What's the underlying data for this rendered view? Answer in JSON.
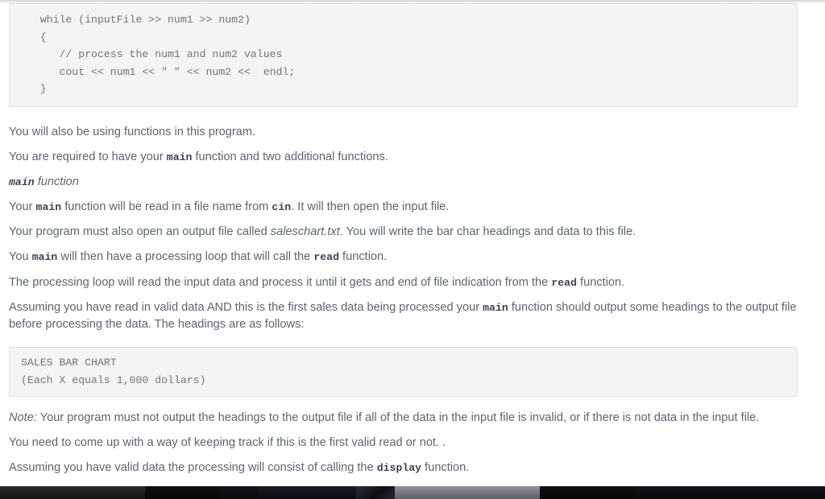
{
  "document": {
    "code_block_1": "   while (inputFile >> num1 >> num2)\n   {\n      // process the num1 and num2 values\n      cout << num1 << \" \" << num2 <<  endl;\n   }",
    "code_block_2": "SALES BAR CHART\n(Each X equals 1,000 dollars)",
    "p1": "You will also be using functions in this program.",
    "p2": {
      "a": "You are required to have your ",
      "code": "main",
      "b": " function and two additional functions."
    },
    "h1": {
      "code": "main",
      "text": " function"
    },
    "p3": {
      "a": "Your ",
      "code1": "main",
      "b": " function will be read in a file name from ",
      "code2": "cin",
      "c": ". It will then open the input file."
    },
    "p4": {
      "a": "Your program must also open an output file called ",
      "italic": "saleschart.txt",
      "b": ". You will write the bar char headings and data to this file."
    },
    "p5": {
      "a": "You ",
      "code1": "main",
      "b": " will then have a processing loop that will call the ",
      "code2": "read",
      "c": " function."
    },
    "p6": {
      "a": "The processing loop will read the input data and process it until it gets and end of file indication from the ",
      "code": "read",
      "b": " function."
    },
    "p7": {
      "a": "Assuming you have read in valid data AND this is the first sales data being processed your ",
      "code": "main",
      "b": " function should output some headings to the output file before processing the data. The headings are as follows:"
    },
    "p8": {
      "italic": "Note:",
      "a": " Your program must not output the headings to the output file if all of the data in the input file is invalid, or if there is not data in the input file."
    },
    "p9": "You need to come up with a way of keeping track if this is the first valid read or not. .",
    "p10": {
      "a": "Assuming you have valid data the processing will consist of calling the ",
      "code": "display",
      "b": " function."
    }
  },
  "colors": {
    "body_text": "#5b6570",
    "code_text": "#6c7680",
    "code_bg": "#f4f4f4",
    "code_border": "#e3e3e3",
    "inline_code_text": "#3c4450",
    "page_bg": "#ffffff"
  }
}
